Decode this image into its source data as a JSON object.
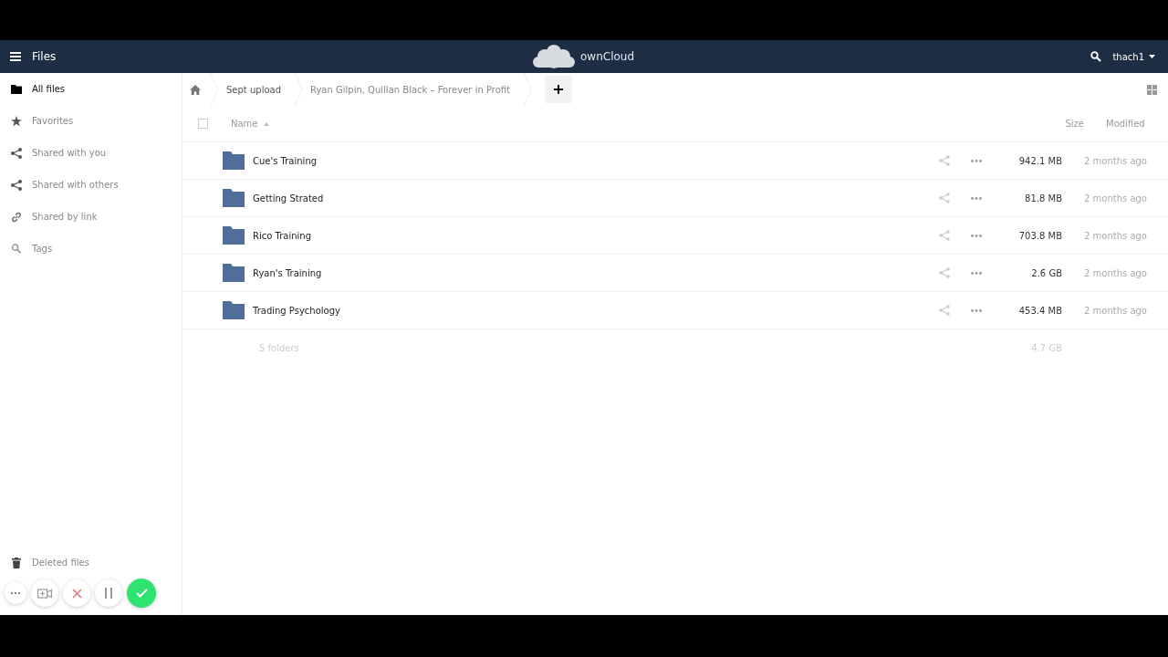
{
  "header": {
    "app_title": "Files",
    "brand": "ownCloud",
    "user": "thach1"
  },
  "sidebar": {
    "items": [
      {
        "label": "All files",
        "kind": "folder",
        "selected": true
      },
      {
        "label": "Favorites",
        "kind": "star",
        "selected": false
      },
      {
        "label": "Shared with you",
        "kind": "share",
        "selected": false
      },
      {
        "label": "Shared with others",
        "kind": "share",
        "selected": false
      },
      {
        "label": "Shared by link",
        "kind": "link",
        "selected": false
      },
      {
        "label": "Tags",
        "kind": "search",
        "selected": false
      }
    ],
    "footer_items": [
      {
        "label": "Deleted files",
        "kind": "trash"
      }
    ]
  },
  "breadcrumbs": [
    "Sept upload",
    "Ryan Gilpin, Quillan Black – Forever in Profit"
  ],
  "table": {
    "columns": [
      "Name",
      "Size",
      "Modified"
    ],
    "all_checked": false,
    "rows": [
      {
        "name": "Cue's Training",
        "size": "942.1 MB",
        "modified": "2 months ago"
      },
      {
        "name": "Getting Strated",
        "size": "81.8 MB",
        "modified": "2 months ago"
      },
      {
        "name": "Rico Training",
        "size": "703.8 MB",
        "modified": "2 months ago"
      },
      {
        "name": "Ryan's Training",
        "size": "2.6 GB",
        "modified": "2 months ago"
      },
      {
        "name": "Trading Psychology",
        "size": "453.4 MB",
        "modified": "2 months ago"
      }
    ],
    "summary": {
      "count": "5 folders",
      "size": "4.7 GB"
    }
  }
}
